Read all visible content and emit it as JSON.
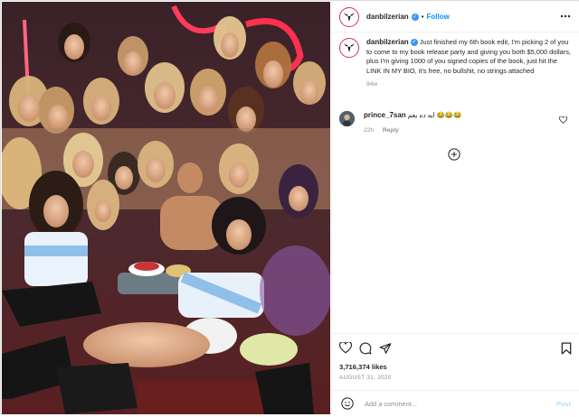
{
  "post": {
    "username": "danbilzerian",
    "follow_label": "Follow",
    "separator": "•",
    "caption": "Just finished my 6th book edit, I'm picking 2 of you to come to my book release party and giving you both $5,000 dollars, plus I'm giving 1000 of you signed copies of the book, just hit the LINK IN MY BIO, it's free, no bullshit, no strings attached",
    "caption_time": "94w",
    "likes": "3,716,374 likes",
    "date": "AUGUST 31, 2020"
  },
  "comment": {
    "username": "prince_7san",
    "text": "ايه ده يعم 😂😂😂",
    "time": "22h",
    "reply_label": "Reply"
  },
  "composer": {
    "placeholder": "Add a comment...",
    "post_label": "Post"
  },
  "icons": {
    "avatar": "bull-logo-icon",
    "like": "heart-icon",
    "comment": "comment-icon",
    "share": "share-icon",
    "save": "bookmark-icon",
    "emoji": "smile-icon",
    "load_more": "plus-circle-icon"
  },
  "colors": {
    "link": "#0095f6",
    "verified": "#3897f0",
    "muted": "#8e8e8e",
    "post_disabled": "#b2dffc"
  }
}
